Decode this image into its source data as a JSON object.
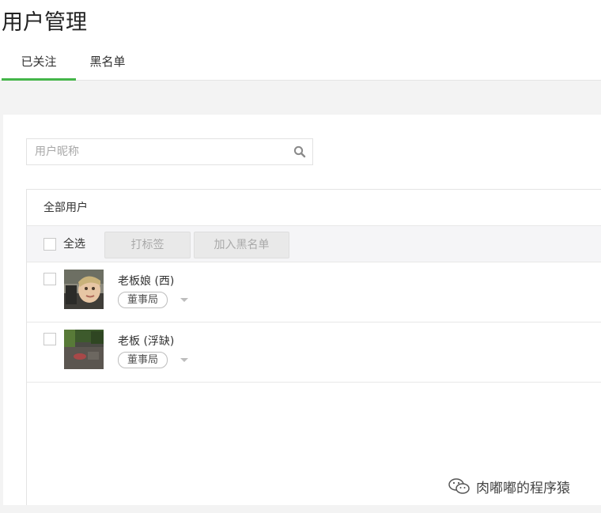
{
  "page": {
    "title": "用户管理"
  },
  "tabs": [
    {
      "label": "已关注",
      "active": true
    },
    {
      "label": "黑名单",
      "active": false
    }
  ],
  "search": {
    "placeholder": "用户昵称",
    "value": ""
  },
  "table": {
    "group_label": "全部用户",
    "select_all_label": "全选",
    "tag_button_label": "打标签",
    "blacklist_button_label": "加入黑名单",
    "rows": [
      {
        "name": "老板娘 (西)",
        "tag": "董事局",
        "avatar": "avatar-photo-child"
      },
      {
        "name": "老板 (浮缺)",
        "tag": "董事局",
        "avatar": "avatar-photo-ground"
      }
    ]
  },
  "watermark": {
    "text": "肉嘟嘟的程序猿",
    "icon": "wechat-icon"
  },
  "colors": {
    "accent": "#44b549",
    "band": "#f3f3f3",
    "button_bg": "#e9e9e9"
  }
}
